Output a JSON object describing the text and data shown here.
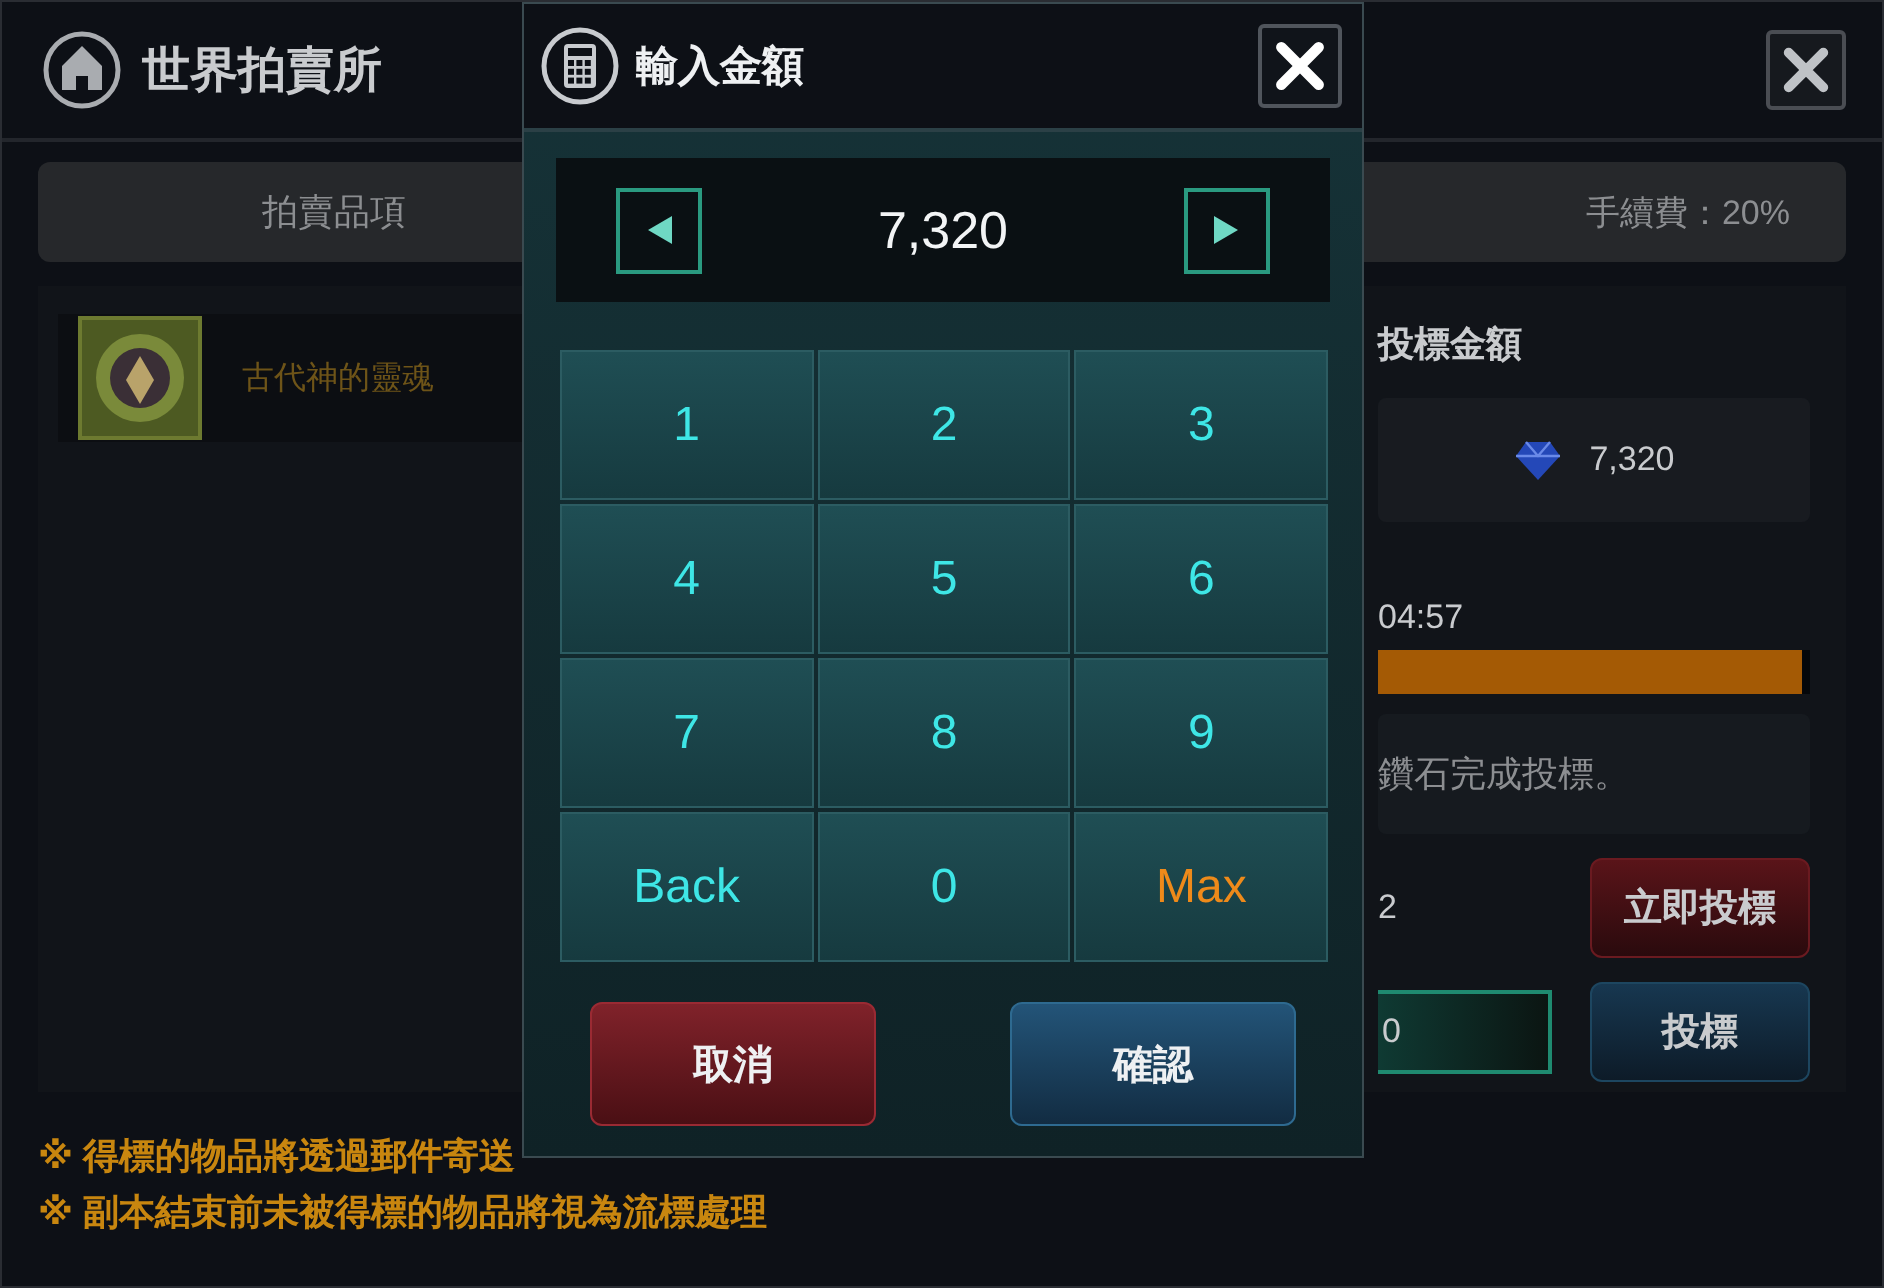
{
  "window": {
    "title": "世界拍賣所"
  },
  "tab_bar": {
    "label": "拍賣品項",
    "fee": "手續費：20%"
  },
  "items": [
    {
      "name": "古代神的靈魂"
    }
  ],
  "bid_panel": {
    "label": "投標金額",
    "price": "7,320",
    "time_left": "04:57",
    "time_bar": {
      "level": 0.98
    },
    "message": "鑽石完成投標。",
    "buyout_price": "2",
    "buyout_button": "立即投標",
    "bid_input": "0",
    "bid_button": "投標"
  },
  "notes": [
    "※ 得標的物品將透過郵件寄送",
    "※ 副本結束前未被得標的物品將視為流標處理"
  ],
  "dialog": {
    "title": "輸入金額",
    "value": "7,320",
    "keys": [
      {
        "label": "1",
        "kind": "digit"
      },
      {
        "label": "2",
        "kind": "digit"
      },
      {
        "label": "3",
        "kind": "digit"
      },
      {
        "label": "4",
        "kind": "digit"
      },
      {
        "label": "5",
        "kind": "digit"
      },
      {
        "label": "6",
        "kind": "digit"
      },
      {
        "label": "7",
        "kind": "digit"
      },
      {
        "label": "8",
        "kind": "digit"
      },
      {
        "label": "9",
        "kind": "digit"
      },
      {
        "label": "Back",
        "kind": "back"
      },
      {
        "label": "0",
        "kind": "digit"
      },
      {
        "label": "Max",
        "kind": "max"
      }
    ],
    "buttons": [
      {
        "label": "取消",
        "kind": "cancel"
      },
      {
        "label": "確認",
        "kind": "confirm"
      }
    ]
  }
}
